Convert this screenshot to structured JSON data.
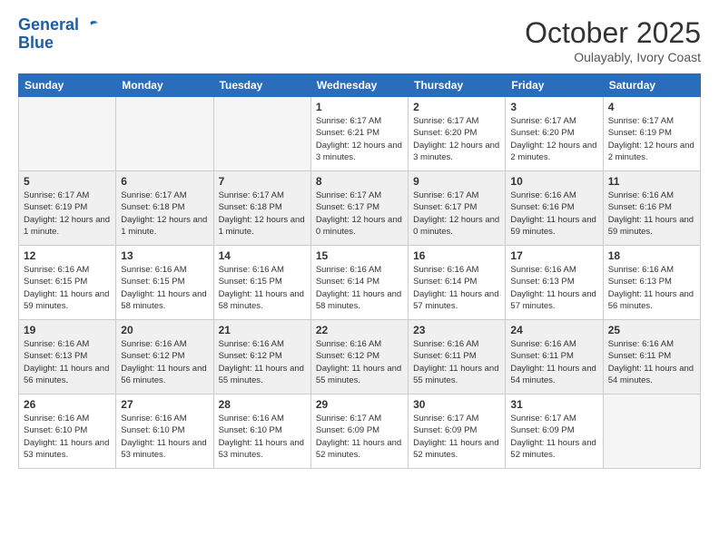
{
  "logo": {
    "line1": "General",
    "line2": "Blue"
  },
  "header": {
    "month": "October 2025",
    "location": "Oulayably, Ivory Coast"
  },
  "weekdays": [
    "Sunday",
    "Monday",
    "Tuesday",
    "Wednesday",
    "Thursday",
    "Friday",
    "Saturday"
  ],
  "weeks": [
    [
      {
        "day": "",
        "info": ""
      },
      {
        "day": "",
        "info": ""
      },
      {
        "day": "",
        "info": ""
      },
      {
        "day": "1",
        "info": "Sunrise: 6:17 AM\nSunset: 6:21 PM\nDaylight: 12 hours and 3 minutes."
      },
      {
        "day": "2",
        "info": "Sunrise: 6:17 AM\nSunset: 6:20 PM\nDaylight: 12 hours and 3 minutes."
      },
      {
        "day": "3",
        "info": "Sunrise: 6:17 AM\nSunset: 6:20 PM\nDaylight: 12 hours and 2 minutes."
      },
      {
        "day": "4",
        "info": "Sunrise: 6:17 AM\nSunset: 6:19 PM\nDaylight: 12 hours and 2 minutes."
      }
    ],
    [
      {
        "day": "5",
        "info": "Sunrise: 6:17 AM\nSunset: 6:19 PM\nDaylight: 12 hours and 1 minute."
      },
      {
        "day": "6",
        "info": "Sunrise: 6:17 AM\nSunset: 6:18 PM\nDaylight: 12 hours and 1 minute."
      },
      {
        "day": "7",
        "info": "Sunrise: 6:17 AM\nSunset: 6:18 PM\nDaylight: 12 hours and 1 minute."
      },
      {
        "day": "8",
        "info": "Sunrise: 6:17 AM\nSunset: 6:17 PM\nDaylight: 12 hours and 0 minutes."
      },
      {
        "day": "9",
        "info": "Sunrise: 6:17 AM\nSunset: 6:17 PM\nDaylight: 12 hours and 0 minutes."
      },
      {
        "day": "10",
        "info": "Sunrise: 6:16 AM\nSunset: 6:16 PM\nDaylight: 11 hours and 59 minutes."
      },
      {
        "day": "11",
        "info": "Sunrise: 6:16 AM\nSunset: 6:16 PM\nDaylight: 11 hours and 59 minutes."
      }
    ],
    [
      {
        "day": "12",
        "info": "Sunrise: 6:16 AM\nSunset: 6:15 PM\nDaylight: 11 hours and 59 minutes."
      },
      {
        "day": "13",
        "info": "Sunrise: 6:16 AM\nSunset: 6:15 PM\nDaylight: 11 hours and 58 minutes."
      },
      {
        "day": "14",
        "info": "Sunrise: 6:16 AM\nSunset: 6:15 PM\nDaylight: 11 hours and 58 minutes."
      },
      {
        "day": "15",
        "info": "Sunrise: 6:16 AM\nSunset: 6:14 PM\nDaylight: 11 hours and 58 minutes."
      },
      {
        "day": "16",
        "info": "Sunrise: 6:16 AM\nSunset: 6:14 PM\nDaylight: 11 hours and 57 minutes."
      },
      {
        "day": "17",
        "info": "Sunrise: 6:16 AM\nSunset: 6:13 PM\nDaylight: 11 hours and 57 minutes."
      },
      {
        "day": "18",
        "info": "Sunrise: 6:16 AM\nSunset: 6:13 PM\nDaylight: 11 hours and 56 minutes."
      }
    ],
    [
      {
        "day": "19",
        "info": "Sunrise: 6:16 AM\nSunset: 6:13 PM\nDaylight: 11 hours and 56 minutes."
      },
      {
        "day": "20",
        "info": "Sunrise: 6:16 AM\nSunset: 6:12 PM\nDaylight: 11 hours and 56 minutes."
      },
      {
        "day": "21",
        "info": "Sunrise: 6:16 AM\nSunset: 6:12 PM\nDaylight: 11 hours and 55 minutes."
      },
      {
        "day": "22",
        "info": "Sunrise: 6:16 AM\nSunset: 6:12 PM\nDaylight: 11 hours and 55 minutes."
      },
      {
        "day": "23",
        "info": "Sunrise: 6:16 AM\nSunset: 6:11 PM\nDaylight: 11 hours and 55 minutes."
      },
      {
        "day": "24",
        "info": "Sunrise: 6:16 AM\nSunset: 6:11 PM\nDaylight: 11 hours and 54 minutes."
      },
      {
        "day": "25",
        "info": "Sunrise: 6:16 AM\nSunset: 6:11 PM\nDaylight: 11 hours and 54 minutes."
      }
    ],
    [
      {
        "day": "26",
        "info": "Sunrise: 6:16 AM\nSunset: 6:10 PM\nDaylight: 11 hours and 53 minutes."
      },
      {
        "day": "27",
        "info": "Sunrise: 6:16 AM\nSunset: 6:10 PM\nDaylight: 11 hours and 53 minutes."
      },
      {
        "day": "28",
        "info": "Sunrise: 6:16 AM\nSunset: 6:10 PM\nDaylight: 11 hours and 53 minutes."
      },
      {
        "day": "29",
        "info": "Sunrise: 6:17 AM\nSunset: 6:09 PM\nDaylight: 11 hours and 52 minutes."
      },
      {
        "day": "30",
        "info": "Sunrise: 6:17 AM\nSunset: 6:09 PM\nDaylight: 11 hours and 52 minutes."
      },
      {
        "day": "31",
        "info": "Sunrise: 6:17 AM\nSunset: 6:09 PM\nDaylight: 11 hours and 52 minutes."
      },
      {
        "day": "",
        "info": ""
      }
    ]
  ]
}
